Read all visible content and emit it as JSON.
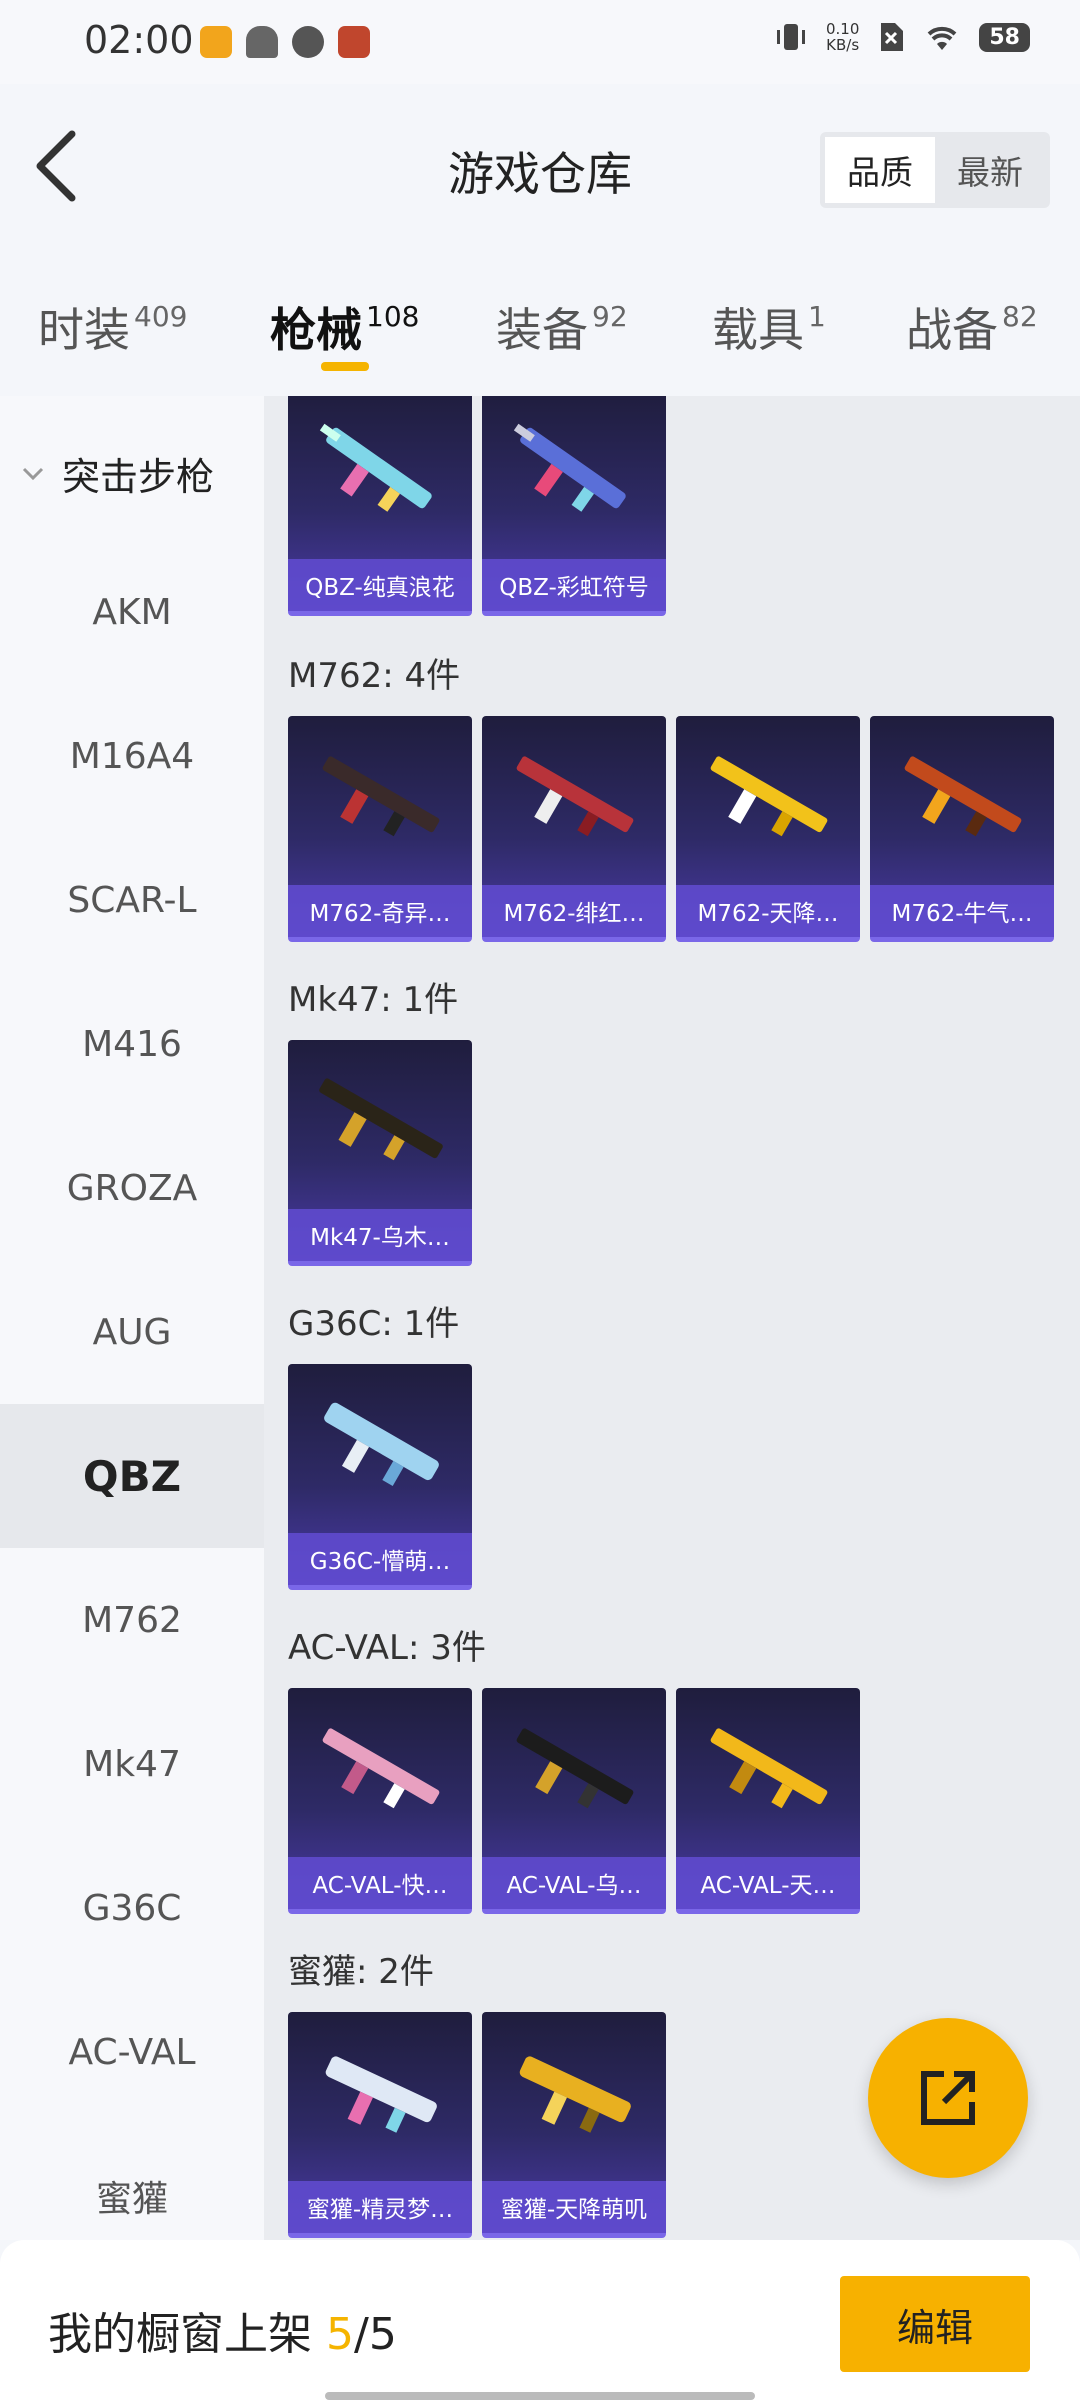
{
  "status_bar": {
    "time": "02:00",
    "speed_value": "0.10",
    "speed_unit": "KB/s",
    "battery": "58"
  },
  "header": {
    "title": "游戏仓库",
    "sort_options": [
      "品质",
      "最新"
    ],
    "sort_selected": "品质"
  },
  "tabs": [
    {
      "label": "时装",
      "count": "409"
    },
    {
      "label": "枪械",
      "count": "108"
    },
    {
      "label": "装备",
      "count": "92"
    },
    {
      "label": "载具",
      "count": "1"
    },
    {
      "label": "战备",
      "count": "82"
    }
  ],
  "active_tab": "枪械",
  "sidebar": {
    "group": "突击步枪",
    "items": [
      "AKM",
      "M16A4",
      "SCAR-L",
      "M416",
      "GROZA",
      "AUG",
      "QBZ",
      "M762",
      "Mk47",
      "G36C",
      "AC-VAL",
      "蜜獾"
    ],
    "selected": "QBZ"
  },
  "sections": [
    {
      "title": "",
      "items": [
        "QBZ-纯真浪花",
        "QBZ-彩虹符号"
      ]
    },
    {
      "title": "M762: 4件",
      "items": [
        "M762-奇异…",
        "M762-绯红…",
        "M762-天降…",
        "M762-牛气…"
      ]
    },
    {
      "title": "Mk47: 1件",
      "items": [
        "Mk47-乌木…"
      ]
    },
    {
      "title": "G36C: 1件",
      "items": [
        "G36C-懵萌…"
      ]
    },
    {
      "title": "AC-VAL: 3件",
      "items": [
        "AC-VAL-快…",
        "AC-VAL-乌…",
        "AC-VAL-天…"
      ]
    },
    {
      "title": "蜜獾: 2件",
      "items": [
        "蜜獾-精灵梦…",
        "蜜獾-天降萌叽"
      ]
    }
  ],
  "footer": {
    "label": "我的橱窗上架",
    "count_current": "5",
    "count_sep": "/",
    "count_total": "5",
    "edit_label": "编辑"
  },
  "colors": {
    "accent": "#f5b400",
    "card_dark": "#2e2a66",
    "card_label": "#614cd2"
  },
  "icons": {
    "back": "back-arrow-icon",
    "share": "share-external-icon",
    "chevron": "chevron-down-icon"
  }
}
